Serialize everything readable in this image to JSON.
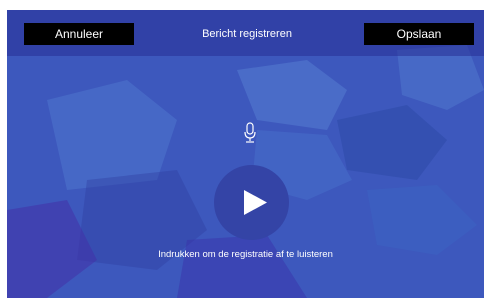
{
  "header": {
    "cancel_label": "Annuleer",
    "title": "Bericht registreren",
    "save_label": "Opslaan"
  },
  "player": {
    "hint": "Indrukken om de registratie af te luisteren"
  },
  "icons": {
    "microphone": "microphone-icon",
    "play": "play-icon"
  },
  "colors": {
    "background": "#3f5cc0",
    "button_bg": "#000000",
    "play_circle": "#3444a6",
    "text": "#ffffff"
  }
}
